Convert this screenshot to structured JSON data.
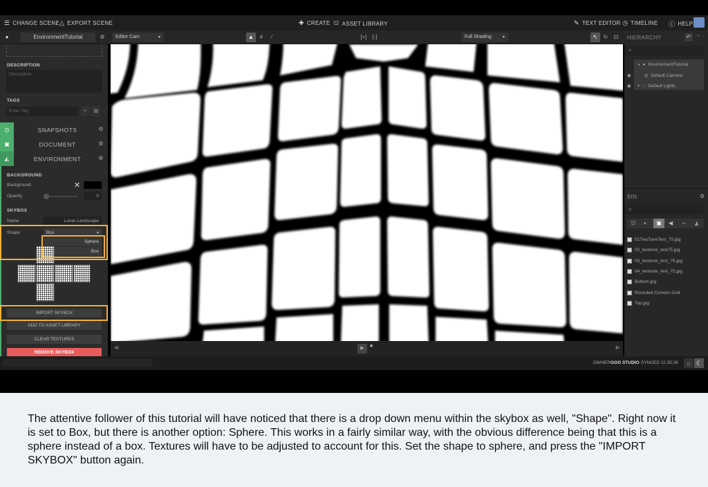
{
  "topbar": {
    "change_scene": "CHANGE SCENE",
    "export_scene": "EXPORT SCENE",
    "create": "CREATE",
    "asset_library": "ASSET LIBRARY",
    "text_editor": "TEXT EDITOR",
    "timeline": "TIMELINE",
    "help": "HELP"
  },
  "toolbar": {
    "scene_name": "EnvironmentTutorial",
    "camera": "Editor Cam",
    "shading": "Full Shading"
  },
  "left_panel": {
    "description_label": "DESCRIPTION",
    "description_placeholder": "Description",
    "tags_label": "TAGS",
    "tag_placeholder": "Enter Tag",
    "sections": [
      "SNAPSHOTS",
      "DOCUMENT",
      "ENVIRONMENT"
    ],
    "background_label": "BACKGROUND",
    "background_field": "Background",
    "opacity_field": "Opacity",
    "opacity_value": "0",
    "skybox_label": "SKYBOX",
    "name_field": "Name",
    "name_value": "Lunar Landscape",
    "shape_field": "Shape",
    "shape_value": "Box",
    "shape_options": [
      "Sphere",
      "Box"
    ],
    "buttons": {
      "import": "IMPORT SKYBOX",
      "add_library": "ADD TO ASSET LIBRARY",
      "clear": "CLEAR TEXTURES",
      "remove": "REMOVE SKYBOX"
    }
  },
  "hierarchy": {
    "title": "HIERARCHY",
    "items": [
      "EnvironmentTutorial",
      "Default Camera",
      "Default Lights"
    ]
  },
  "bin": {
    "title": "BIN",
    "files": [
      "01TwoToneTest_75.jpg",
      "02_twotone_test75.jpg",
      "03_twotone_test_75.jpg",
      "04_twotone_test_75.jpg",
      "Bottom.jpg",
      "Rounded Corners Grid",
      "Top.jpg"
    ]
  },
  "status": {
    "owner_label": "OWNER",
    "owner_value": "GOO STUDIO",
    "synced": "SYNCED 11:35:26"
  },
  "caption": "The attentive follower of this tutorial will have noticed that there is a drop down menu within the skybox as well, \"Shape\". Right now it is set to Box, but there is another option: Sphere. This works in a fairly similar way, with the obvious difference being that this is a sphere instead of a box. Textures will have to be adjusted to account for this. Set the shape to sphere, and press the \"IMPORT SKYBOX\" button again."
}
